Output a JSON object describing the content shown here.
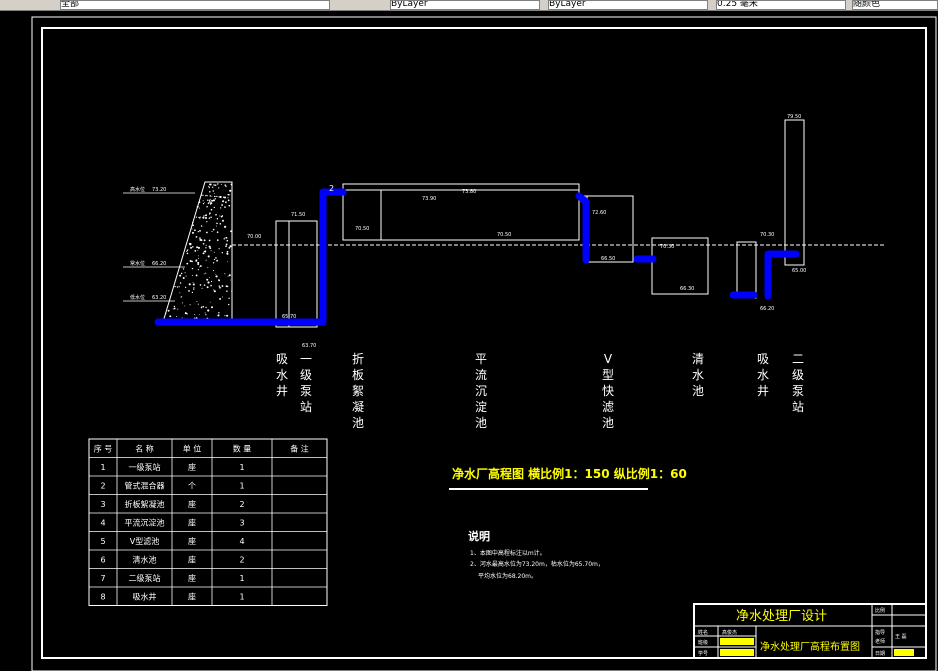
{
  "toolbar": {
    "layer_field": "全部",
    "color_field": "ByLayer",
    "linetype_field": "ByLayer",
    "lineweight_field": "0.25 毫米",
    "plotstyle_field": "随颜色"
  },
  "process_labels": [
    {
      "id": "intake-well",
      "text": "吸水井"
    },
    {
      "id": "pump-station-1",
      "text": "一级泵站"
    },
    {
      "id": "flocculation",
      "text": "折板絮凝池"
    },
    {
      "id": "sedimentation",
      "text": "平流沉淀池"
    },
    {
      "id": "v-filter",
      "text": "V型快滤池"
    },
    {
      "id": "clear-well",
      "text": "清水池"
    },
    {
      "id": "suction-well",
      "text": "吸水井"
    },
    {
      "id": "pump-station-2",
      "text": "二级泵站"
    }
  ],
  "water_levels": {
    "high": "高水位",
    "normal": "常水位",
    "low": "低水位",
    "high_val": "73.20",
    "normal_val": "66.20",
    "low_val": "63.20"
  },
  "elevations": [
    "70.00",
    "71.50",
    "65.70",
    "63.70",
    "73.90",
    "73.80",
    "70.50",
    "70.50",
    "72.60",
    "66.50",
    "70.30",
    "66.30",
    "70.30",
    "66.20",
    "65.00",
    "79.50"
  ],
  "marker": "2",
  "drawing_title": "净水厂高程图 横比例1：150 纵比例1：60",
  "table": {
    "headers": [
      "序 号",
      "名 称",
      "单 位",
      "数 量",
      "备 注"
    ],
    "rows": [
      [
        "1",
        "一级泵站",
        "座",
        "1",
        ""
      ],
      [
        "2",
        "管式混合器",
        "个",
        "1",
        ""
      ],
      [
        "3",
        "折板絮凝池",
        "座",
        "2",
        ""
      ],
      [
        "4",
        "平流沉淀池",
        "座",
        "3",
        ""
      ],
      [
        "5",
        "V型滤池",
        "座",
        "4",
        ""
      ],
      [
        "6",
        "清水池",
        "座",
        "2",
        ""
      ],
      [
        "7",
        "二级泵站",
        "座",
        "1",
        ""
      ],
      [
        "8",
        "吸水井",
        "座",
        "1",
        ""
      ]
    ]
  },
  "notes": {
    "title": "说明",
    "line1": "1、本图中高程标注以m计。",
    "line2": "2、河水最高水位为73.20m，枯水位为65.70m，",
    "line3": "平均水位为68.20m。"
  },
  "title_block": {
    "project": "净水处理厂设计",
    "drawing_name": "净水处理厂高程布置图",
    "label_ratio": "比例",
    "label_design": "班级",
    "label_draw": "设计",
    "label_student_no": "学号",
    "label_checker": "指导",
    "label_teacher": "老师",
    "label_date": "日期",
    "label_name": "姓名",
    "designer": "高俊杰",
    "checker_name": "王 磊"
  },
  "colors": {
    "pipe": "#0000ff",
    "line": "#ffffff",
    "title": "#ffff00",
    "highlight": "#ffff00"
  }
}
